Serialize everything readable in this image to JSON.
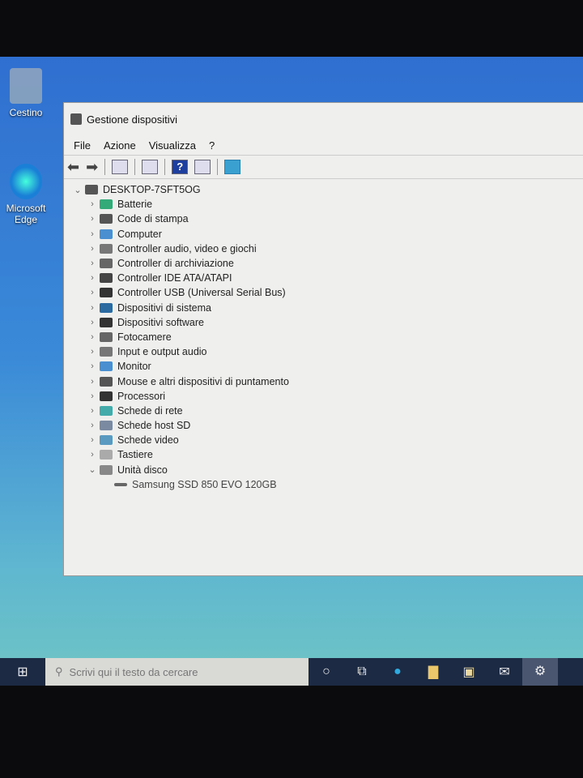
{
  "desktop": {
    "icons": [
      {
        "label": "Cestino"
      },
      {
        "label": "Microsoft Edge"
      }
    ]
  },
  "window": {
    "title": "Gestione dispositivi",
    "menu": [
      "File",
      "Azione",
      "Visualizza",
      "?"
    ],
    "toolbar": [
      "back-icon",
      "forward-icon",
      "show-hide-console-tree-icon",
      "properties-icon",
      "help-icon",
      "action-pane-icon",
      "scan-hardware-icon"
    ],
    "root": "DESKTOP-7SFT5OG",
    "categories": [
      "Batterie",
      "Code di stampa",
      "Computer",
      "Controller audio, video e giochi",
      "Controller di archiviazione",
      "Controller IDE ATA/ATAPI",
      "Controller USB (Universal Serial Bus)",
      "Dispositivi di sistema",
      "Dispositivi software",
      "Fotocamere",
      "Input e output audio",
      "Monitor",
      "Mouse e altri dispositivi di puntamento",
      "Processori",
      "Schede di rete",
      "Schede host SD",
      "Schede video",
      "Tastiere",
      "Unità disco"
    ],
    "expanded_child": "Samsung SSD 850 EVO 120GB"
  },
  "taskbar": {
    "search_placeholder": "Scrivi qui il testo da cercare"
  }
}
